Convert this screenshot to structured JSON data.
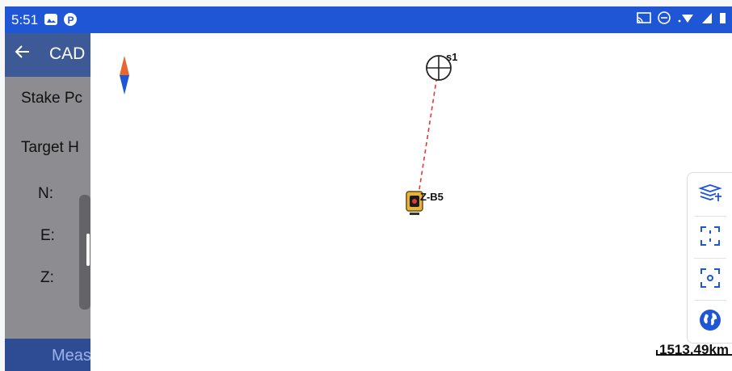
{
  "status_bar": {
    "time": "5:51",
    "color": "#1f56d6",
    "icons": [
      "gallery-icon",
      "parking-icon",
      "cast-icon",
      "do-not-disturb-icon",
      "wifi-icon",
      "signal-icon",
      "battery-icon"
    ]
  },
  "left_panel": {
    "title": "CAD",
    "rows": {
      "stake_point": "Stake Pc",
      "target_height": "Target H",
      "n": "N:",
      "e": "E:",
      "z": "Z:"
    },
    "bottom_button": "Meas"
  },
  "map": {
    "target_label": "s1",
    "instrument_label": "Z-B5",
    "scale": "1513.49km",
    "colors": {
      "stakeline": "#e03a3a",
      "compass_north": "#e8662f",
      "compass_south": "#1f56d6"
    }
  },
  "toolbar": {
    "buttons": [
      "layers-icon",
      "zoom-extents-icon",
      "center-location-icon",
      "globe-icon"
    ]
  }
}
